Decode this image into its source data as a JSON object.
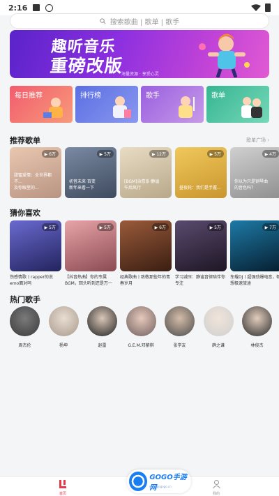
{
  "status": {
    "time": "2:16"
  },
  "search": {
    "placeholder": "搜索歌曲 | 歌单 | 歌手"
  },
  "banner": {
    "line1": "趣听音乐",
    "line2": "重磅改版",
    "small": "海量资源 · 享受心灵"
  },
  "categories": [
    {
      "label": "每日推荐",
      "color": "#f0616e"
    },
    {
      "label": "排行榜",
      "color": "#6f7ee8"
    },
    {
      "label": "歌手",
      "color": "#a06ee0"
    },
    {
      "label": "歌单",
      "color": "#3fbf9c"
    }
  ],
  "recommended": {
    "title": "推荐歌单",
    "more": "歌单广场 ›",
    "items": [
      {
        "play": "▶ 6万",
        "title": "甜蜜爱情：全世界都不...",
        "sub": "及你眼里的...",
        "color": "#d6b8a4"
      },
      {
        "play": "▶ 5万",
        "title": "初音未来·百变",
        "sub": "新年来看一下",
        "color": "#5d6e83"
      },
      {
        "play": "▶ 12万",
        "title": "[BGM]治愈系·静谧",
        "sub": "午后风行",
        "color": "#d9cbb0"
      },
      {
        "play": "▶ 5万",
        "title": "昼夜轮：我们是手握...",
        "sub": "",
        "color": "#e2b64a"
      },
      {
        "play": "▶ 4万",
        "title": "你以为只是钢琴曲",
        "sub": "的音色吗？",
        "color": "#b8b8b8"
      }
    ]
  },
  "guess": {
    "title": "猜你喜欢",
    "items": [
      {
        "play": "▶ 5万",
        "title": "伤感情歌丨rapper的说emo面对吗",
        "color": "#3a3a8f"
      },
      {
        "play": "▶ 5万",
        "title": "【抖音热曲】你的专属BGM，回头听到还是万一",
        "color": "#b46a70"
      },
      {
        "play": "▶ 6万",
        "title": "经典歌曲丨致敬那些年的青春岁月",
        "color": "#6a3a28"
      },
      {
        "play": "▶ 5万",
        "title": "学习减压：静谧音律陪伴你专注",
        "color": "#3a2d4a"
      },
      {
        "play": "▶ 7万",
        "title": "车载DJ丨超强劲爆电音，畅想极速旅途",
        "color": "#0b3c5a"
      }
    ]
  },
  "singers": {
    "title": "热门歌手",
    "items": [
      {
        "name": "周杰伦",
        "color": "#4a4a4a"
      },
      {
        "name": "杨坤",
        "color": "#c7bdb2"
      },
      {
        "name": "赵雷",
        "color": "#2a2a2a"
      },
      {
        "name": "G.E.M.邓紫棋",
        "color": "#8a7a7a"
      },
      {
        "name": "张学友",
        "color": "#5a5a5a"
      },
      {
        "name": "薛之谦",
        "color": "#dcdcdc"
      },
      {
        "name": "林俊杰",
        "color": "#3a3a3a"
      }
    ]
  },
  "nav": {
    "home": "首页",
    "mine": "我的"
  },
  "watermark": {
    "text": "GOGO手游网",
    "url": "www.gogogo.cn"
  }
}
